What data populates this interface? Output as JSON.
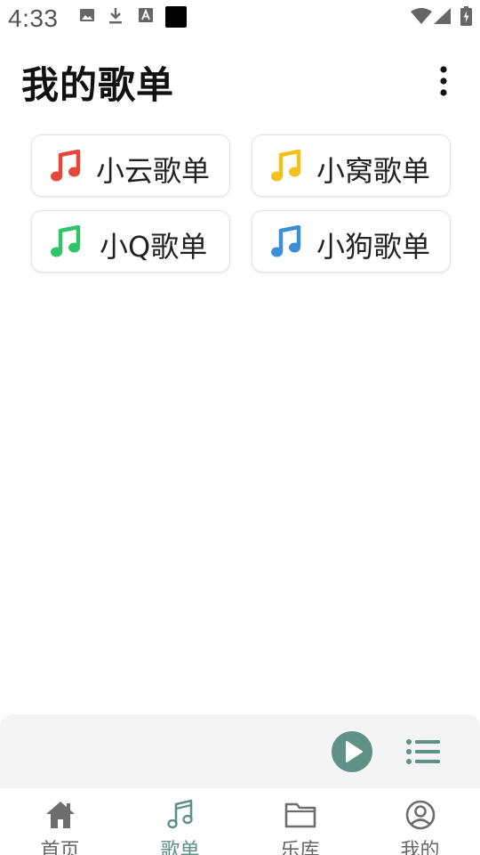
{
  "status_bar": {
    "time": "4:33",
    "left_icons": [
      "image-icon",
      "download-icon",
      "font-a-icon",
      "black-square-icon"
    ],
    "right_icons": [
      "wifi-icon",
      "signal-icon",
      "battery-charging-icon"
    ]
  },
  "header": {
    "title": "我的歌单",
    "more_icon": "more-vert-icon"
  },
  "playlists": [
    {
      "label": "小云歌单",
      "icon": "music-note-icon",
      "color": "#e4473c"
    },
    {
      "label": "小窝歌单",
      "icon": "music-note-icon",
      "color": "#f2c21a"
    },
    {
      "label": "小Q歌单",
      "icon": "music-note-icon",
      "color": "#2fc46b"
    },
    {
      "label": "小狗歌单",
      "icon": "music-note-icon",
      "color": "#3a8fd6"
    }
  ],
  "mini_player": {
    "play_icon": "play-circle-icon",
    "list_icon": "playlist-icon",
    "accent": "#5f9187"
  },
  "bottom_nav": {
    "active_index": 1,
    "active_color": "#5f9187",
    "items": [
      {
        "label": "首页",
        "icon": "home-icon"
      },
      {
        "label": "歌单",
        "icon": "music-note-icon"
      },
      {
        "label": "乐库",
        "icon": "folder-icon"
      },
      {
        "label": "我的",
        "icon": "account-circle-icon"
      }
    ]
  }
}
